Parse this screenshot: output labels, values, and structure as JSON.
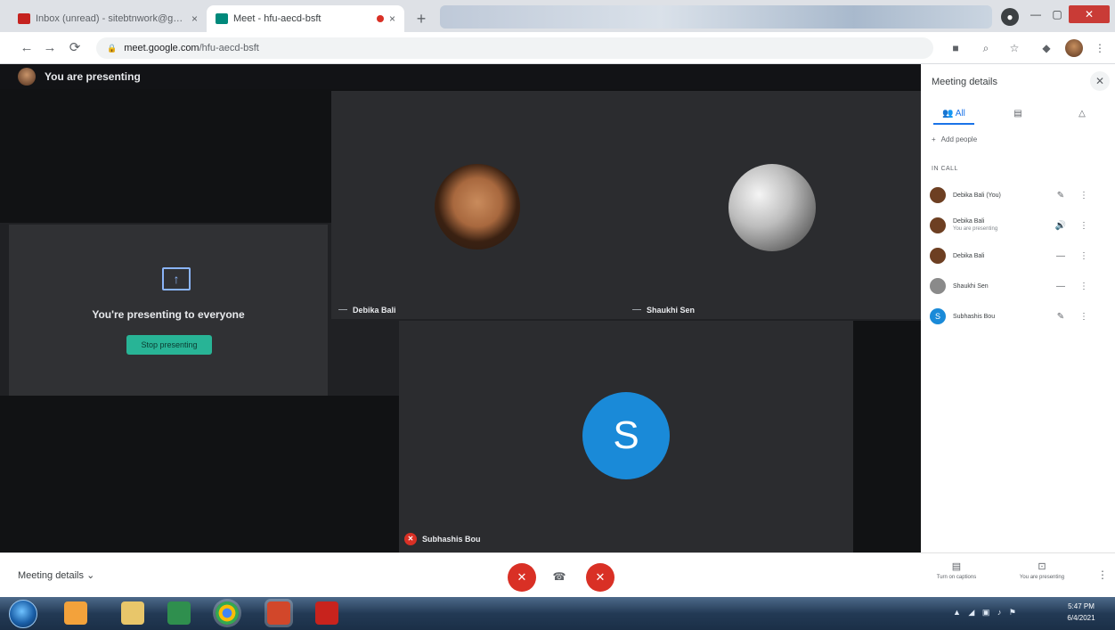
{
  "browser": {
    "tabs": [
      {
        "title": "Inbox (unread) - sitebtnwork@gmail.com",
        "close": "×",
        "favicon_color": "#c5221f"
      },
      {
        "title": "Meet - hfu-aecd-bsft",
        "close": "×",
        "favicon_color": "#00897b"
      }
    ],
    "new_tab": "+",
    "profile_chip": "●",
    "window_controls": {
      "minimize": "—",
      "maximize": "▢",
      "close": "✕"
    },
    "nav": {
      "back": "←",
      "forward": "→",
      "reload": "⟳"
    },
    "url_host": "meet.google.com",
    "url_path": "/hfu-aecd-bsft",
    "lock": "🔒",
    "toolbar_icons": [
      "camera-icon",
      "zoom-icon",
      "star-icon",
      "extensions-icon",
      "menu-icon"
    ],
    "toolbar_icon_glyphs": [
      "■",
      "⌕",
      "☆",
      "◆",
      "⋮"
    ]
  },
  "meet": {
    "presenting_banner": "You are presenting",
    "presenting_to_everyone": "You're presenting to everyone",
    "stop_presenting": "Stop presenting",
    "present_icon": "↑",
    "tiles": [
      {
        "name": "Debika Bali",
        "mic": "—"
      },
      {
        "name": "Shaukhi Sen",
        "mic": "—"
      },
      {
        "name": "Subhashis Bou",
        "initial": "S",
        "mic": "✕"
      }
    ]
  },
  "panel": {
    "title": "Meeting details",
    "close": "✕",
    "tabs": [
      {
        "label": "All",
        "icon": "👥"
      },
      {
        "label": "",
        "icon": "▤"
      },
      {
        "label": "",
        "icon": "△"
      }
    ],
    "add_people": "Add people",
    "add_people_icon": "+",
    "section": "IN CALL",
    "participants": [
      {
        "name": "Debika Bali (You)",
        "sub": "",
        "av_color": "#6d3f22",
        "initial": "",
        "mic": "✎",
        "more": "⋮"
      },
      {
        "name": "Debika Bali",
        "sub": "You are presenting",
        "av_color": "#6d3f22",
        "initial": "",
        "mic": "🔊",
        "more": "⋮"
      },
      {
        "name": "Debika Bali",
        "sub": "",
        "av_color": "#6d3f22",
        "initial": "",
        "mic": "—",
        "more": "⋮"
      },
      {
        "name": "Shaukhi Sen",
        "sub": "",
        "av_color": "#8a8a8a",
        "initial": "",
        "mic": "—",
        "more": "⋮"
      },
      {
        "name": "Subhashis Bou",
        "sub": "",
        "av_color": "#1a8ad8",
        "initial": "S",
        "mic": "✎",
        "more": "⋮"
      }
    ]
  },
  "callbar": {
    "meeting_details": "Meeting details",
    "meeting_details_chevron": "⌄",
    "mic_btn": "✕",
    "cam_btn": "✕",
    "hangup": "☎",
    "captions": {
      "icon": "▤",
      "label": "Turn on captions"
    },
    "presenting": {
      "icon": "⊡",
      "label": "You are presenting"
    },
    "more": "⋮"
  },
  "taskbar": {
    "apps": [
      {
        "name": "media-player-app",
        "color": "#f3a23b"
      },
      {
        "name": "file-explorer-app",
        "color": "#e8c66a"
      },
      {
        "name": "excel-app",
        "color": "#2f8f4e"
      },
      {
        "name": "chrome-app",
        "color": "#e6b32b",
        "active": true
      },
      {
        "name": "powerpoint-app",
        "color": "#d2472a"
      },
      {
        "name": "acrobat-app",
        "color": "#c8231d"
      }
    ],
    "tray": "▲ ◢ ▣ ♪ ⚑",
    "time": "5:47 PM",
    "date": "6/4/2021"
  },
  "colors": {
    "accent": "#1a73e8",
    "danger": "#d93025",
    "stop_button": "#28b496",
    "avatar_blue": "#1a8ad8"
  }
}
